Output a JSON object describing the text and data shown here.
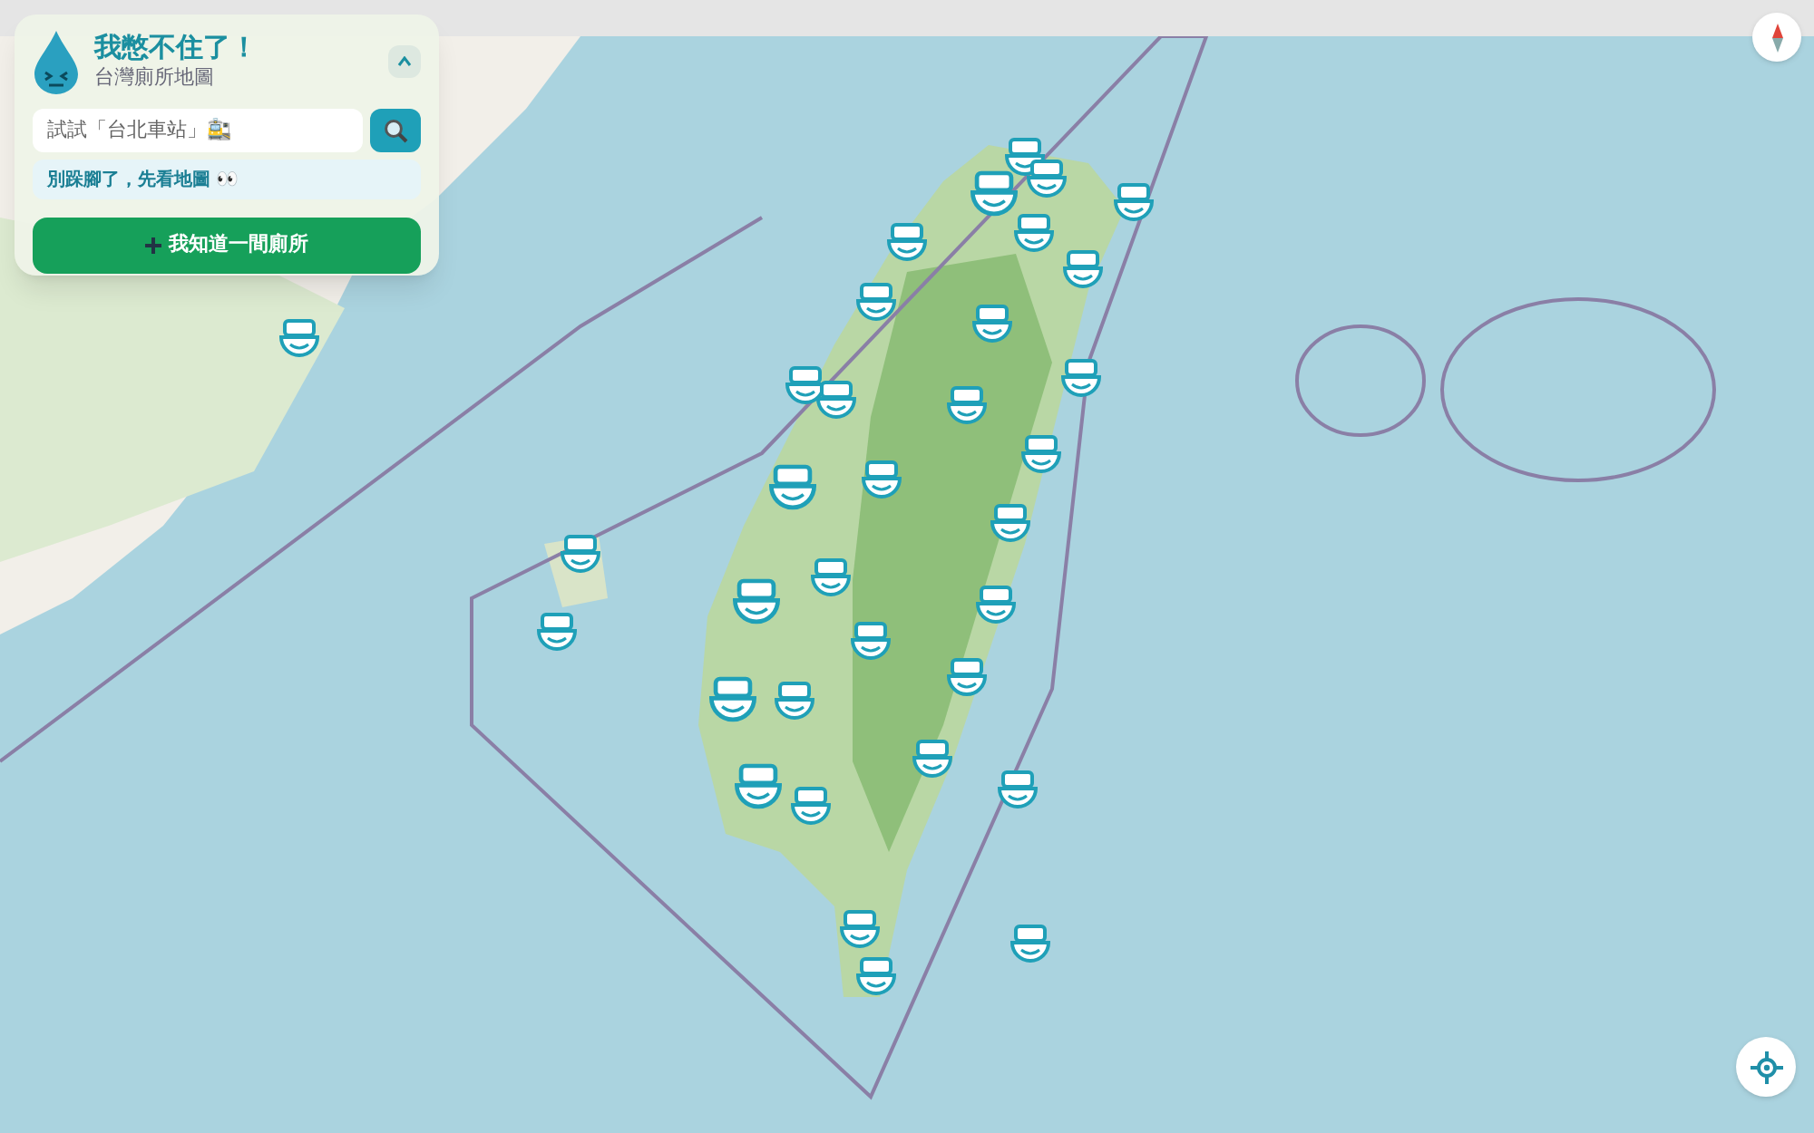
{
  "panel": {
    "title": "我憋不住了！",
    "subtitle": "台灣廁所地圖",
    "collapsed": false
  },
  "search": {
    "placeholder": "試試「台北車站」🚉"
  },
  "hint": "別跺腳了，先看地圖 👀",
  "add_button": {
    "label": "我知道一間廁所"
  }
}
